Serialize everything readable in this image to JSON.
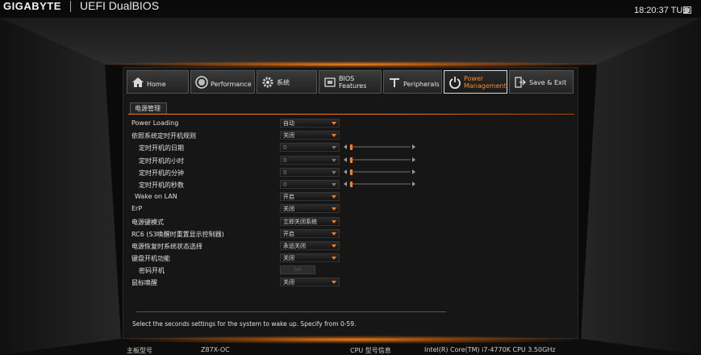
{
  "header": {
    "brand": "GIGABYTE",
    "product": "UEFI DualBIOS",
    "clock": "18:20:37 TUE"
  },
  "tabs": [
    {
      "label": "Home",
      "icon": "home-icon",
      "active": false
    },
    {
      "label": "Performance",
      "icon": "gauge-icon",
      "active": false
    },
    {
      "label": "系统",
      "icon": "gear-icon",
      "active": false
    },
    {
      "label": "BIOS\nFeatures",
      "icon": "bios-chip-icon",
      "active": false
    },
    {
      "label": "Peripherals",
      "icon": "peripherals-icon",
      "active": false
    },
    {
      "label": "Power\nManagement",
      "icon": "power-icon",
      "active": true
    },
    {
      "label": "Save & Exit",
      "icon": "exit-icon",
      "active": false
    }
  ],
  "section": {
    "title": "电源管理"
  },
  "settings": [
    {
      "label": "Power Loading",
      "value": "自动",
      "indent": 0,
      "control": "dropdown"
    },
    {
      "label": "依照系统定时开机规则",
      "value": "关闭",
      "indent": 0,
      "control": "dropdown"
    },
    {
      "label": "定时开机的日期",
      "value": "0",
      "indent": 2,
      "control": "dropdown-slider",
      "dim": true
    },
    {
      "label": "定时开机的小时",
      "value": "0",
      "indent": 2,
      "control": "dropdown-slider",
      "dim": true
    },
    {
      "label": "定时开机的分钟",
      "value": "0",
      "indent": 2,
      "control": "dropdown-slider",
      "dim": true
    },
    {
      "label": "定时开机的秒数",
      "value": "0",
      "indent": 2,
      "control": "dropdown-slider",
      "dim": true
    },
    {
      "label": "Wake on LAN",
      "value": "开启",
      "indent": 1,
      "control": "dropdown"
    },
    {
      "label": "ErP",
      "value": "关闭",
      "indent": 0,
      "control": "dropdown"
    },
    {
      "label": "电源键模式",
      "value": "立即关闭系统",
      "indent": 0,
      "control": "dropdown"
    },
    {
      "label": "RC6 (S3唤醒时重置显示控制器)",
      "value": "开启",
      "indent": 0,
      "control": "dropdown"
    },
    {
      "label": "电源恢复时系统状态选择",
      "value": "永远关闭",
      "indent": 0,
      "control": "dropdown"
    },
    {
      "label": "键盘开机功能",
      "value": "关闭",
      "indent": 0,
      "control": "dropdown"
    },
    {
      "label": "密码开机",
      "value": "Set",
      "indent": 2,
      "control": "button-disabled"
    },
    {
      "label": "鼠标唤醒",
      "value": "关闭",
      "indent": 0,
      "control": "dropdown"
    }
  ],
  "help_text": "Select the seconds settings for the system to wake up. Specify from 0-59.",
  "footer": {
    "model_label": "主板型号",
    "model_value": "Z87X-OC",
    "cpu_label": "CPU 型号信息",
    "cpu_value": "Intel(R) Core(TM) i7-4770K CPU  3.50GHz"
  },
  "colors": {
    "accent": "#ff7b12",
    "background": "#0a0a0a",
    "panel": "#161616"
  }
}
